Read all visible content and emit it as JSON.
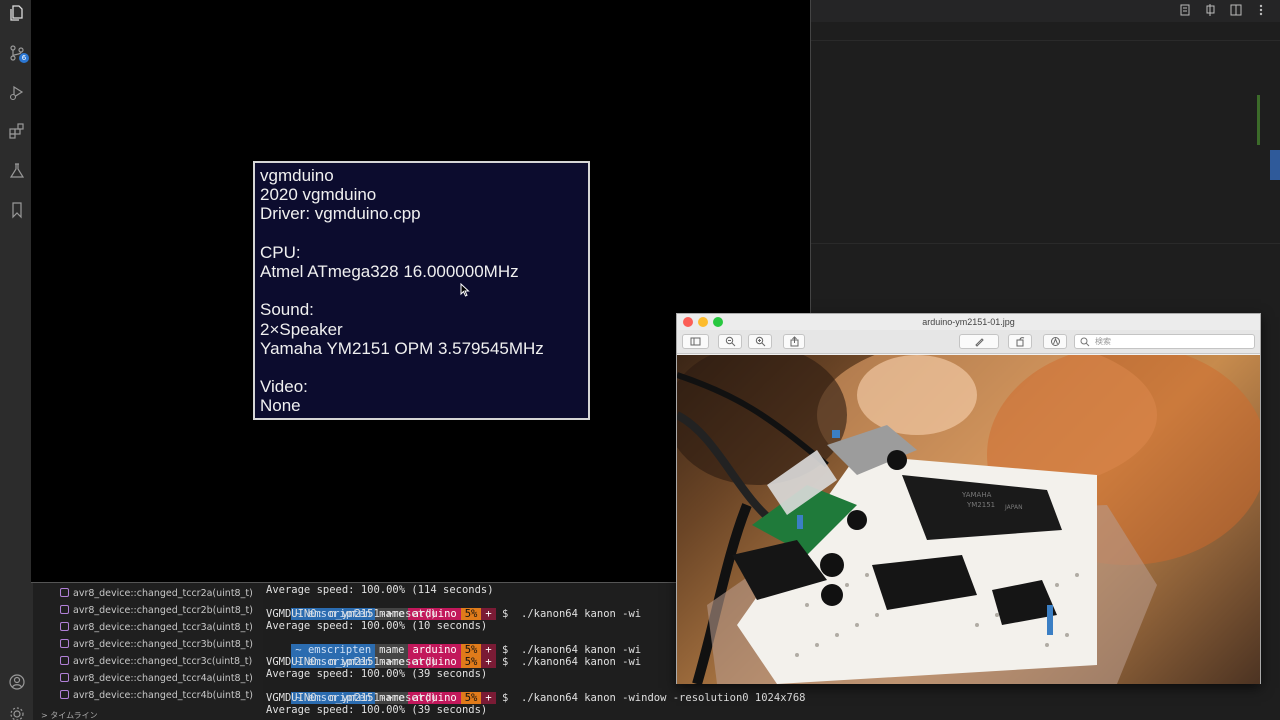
{
  "activity_bar": {
    "icons": [
      "files-icon",
      "source-control-icon",
      "run-debug-icon",
      "extensions-icon",
      "testing-icon",
      "bookmark-icon",
      "account-icon",
      "settings-gear-icon"
    ],
    "source_control_badge": "6"
  },
  "emulator": {
    "info_lines": [
      "vgmduino",
      "2020 vgmduino",
      "Driver: vgmduino.cpp",
      "",
      "CPU:",
      "Atmel ATmega328 16.000000MHz",
      "",
      "Sound:",
      "2×Speaker",
      "Yamaha YM2151 OPM 3.579545MHz",
      "",
      "Video:",
      "None"
    ]
  },
  "outline": {
    "items": [
      "avr8_device::changed_tccr2a(uint8_t)",
      "avr8_device::changed_tccr2b(uint8_t)",
      "avr8_device::changed_tccr3a(uint8_t)",
      "avr8_device::changed_tccr3b(uint8_t)",
      "avr8_device::changed_tccr3c(uint8_t)",
      "avr8_device::changed_tccr4a(uint8_t)",
      "avr8_device::changed_tccr4b(uint8_t)"
    ],
    "footer": "> タイムライン"
  },
  "terminal": {
    "lines": [
      {
        "type": "text",
        "text": "Average speed: 100.00% (114 seconds)"
      },
      {
        "type": "prompt",
        "env": "emscripten",
        "dir": "mame",
        "branch": "arduino",
        "pct": "5%",
        "plus": "+",
        "cmd": "$  ./kanon64 kanon -wi"
      },
      {
        "type": "text",
        "text": "VGMDUINO: m_ym2151->reset()"
      },
      {
        "type": "text",
        "text": "Average speed: 100.00% (10 seconds)"
      },
      {
        "type": "prompt",
        "env": "emscripten",
        "dir": "mame",
        "branch": "arduino",
        "pct": "5%",
        "plus": "+",
        "cmd": "$  ./kanon64 kanon -wi"
      },
      {
        "type": "prompt",
        "env": "emscripten",
        "dir": "mame",
        "branch": "arduino",
        "pct": "5%",
        "plus": "+",
        "cmd": "$  ./kanon64 kanon -wi"
      },
      {
        "type": "text",
        "text": "VGMDUINO: m_ym2151->reset()"
      },
      {
        "type": "text",
        "text": "Average speed: 100.00% (39 seconds)"
      },
      {
        "type": "prompt",
        "env": "emscripten",
        "dir": "mame",
        "branch": "arduino",
        "pct": "5%",
        "plus": "+",
        "cmd": "$  ./kanon64 kanon -window -resolution0 1024x768"
      },
      {
        "type": "text",
        "text": "VGMDUINO: m_ym2151->reset()"
      },
      {
        "type": "text",
        "text": "Average speed: 100.00% (39 seconds)"
      }
    ]
  },
  "preview_window": {
    "title": "arduino-ym2151-01.jpg",
    "search_placeholder": "検索",
    "toolbar_icons": [
      "sidebar-icon",
      "zoom-out-icon",
      "zoom-in-icon",
      "share-icon",
      "markup-pen-icon",
      "rotate-icon",
      "annotate-icon",
      "search-icon"
    ],
    "chip_text": [
      "YAMAHA",
      "YM2151",
      "JAPAN"
    ],
    "colors": {
      "close": "#fc5f57",
      "minimize": "#fdbc2e",
      "zoom": "#28c840"
    }
  }
}
